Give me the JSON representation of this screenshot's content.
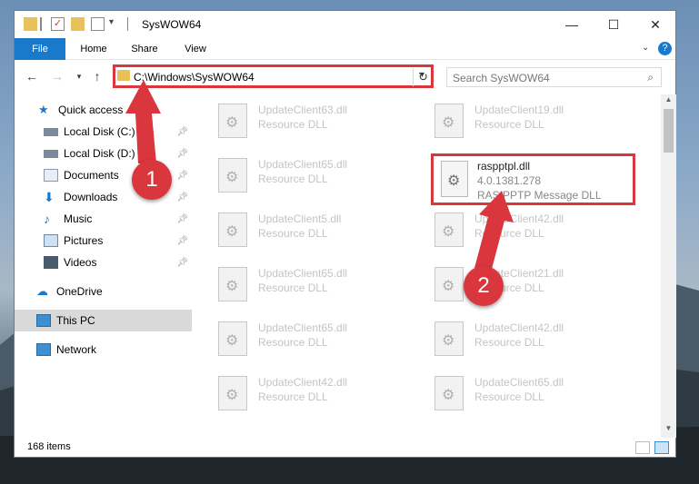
{
  "window": {
    "title": "SysWOW64",
    "controls": [
      "minimize-icon",
      "maximize-icon",
      "close-icon"
    ]
  },
  "ribbon": {
    "tabs": [
      "File",
      "Home",
      "Share",
      "View"
    ]
  },
  "navigation": {
    "address": "C:\\Windows\\SysWOW64",
    "search_placeholder": "Search SysWOW64"
  },
  "sidebar": {
    "items": [
      {
        "label": "Quick access",
        "icon": "star-icon",
        "pinned": false
      },
      {
        "label": "Local Disk (C:)",
        "icon": "drive-icon",
        "pinned": true
      },
      {
        "label": "Local Disk (D:)",
        "icon": "drive-icon",
        "pinned": true
      },
      {
        "label": "Documents",
        "icon": "documents-icon",
        "pinned": true
      },
      {
        "label": "Downloads",
        "icon": "download-icon",
        "pinned": true
      },
      {
        "label": "Music",
        "icon": "music-icon",
        "pinned": true
      },
      {
        "label": "Pictures",
        "icon": "pictures-icon",
        "pinned": true
      },
      {
        "label": "Videos",
        "icon": "videos-icon",
        "pinned": true
      },
      {
        "label": "OneDrive",
        "icon": "cloud-icon",
        "pinned": false
      },
      {
        "label": "This PC",
        "icon": "computer-icon",
        "pinned": false,
        "selected": true
      },
      {
        "label": "Network",
        "icon": "network-icon",
        "pinned": false
      }
    ]
  },
  "files": [
    {
      "name": "UpdateClient63.dll",
      "type": "Resource DLL"
    },
    {
      "name": "UpdateClient19.dll",
      "type": "Resource DLL"
    },
    {
      "name": "UpdateClient65.dll",
      "type": "Resource DLL"
    },
    {
      "name": "raspptpl.dll",
      "version": "4.0.1381.278",
      "description": "RAS PPTP Message DLL",
      "highlighted": true
    },
    {
      "name": "UpdateClient5.dll",
      "type": "Resource DLL"
    },
    {
      "name": "UpdateClient42.dll",
      "type": "Resource DLL"
    },
    {
      "name": "UpdateClient65.dll",
      "type": "Resource DLL"
    },
    {
      "name": "UpdateClient21.dll",
      "type": "Resource DLL"
    },
    {
      "name": "UpdateClient65.dll",
      "type": "Resource DLL"
    },
    {
      "name": "UpdateClient42.dll",
      "type": "Resource DLL"
    },
    {
      "name": "UpdateClient42.dll",
      "type": "Resource DLL"
    },
    {
      "name": "UpdateClient65.dll",
      "type": "Resource DLL"
    }
  ],
  "status": {
    "item_count": "168 items"
  },
  "annotations": {
    "step1": "1",
    "step2": "2",
    "highlight_color": "#d9363e"
  }
}
